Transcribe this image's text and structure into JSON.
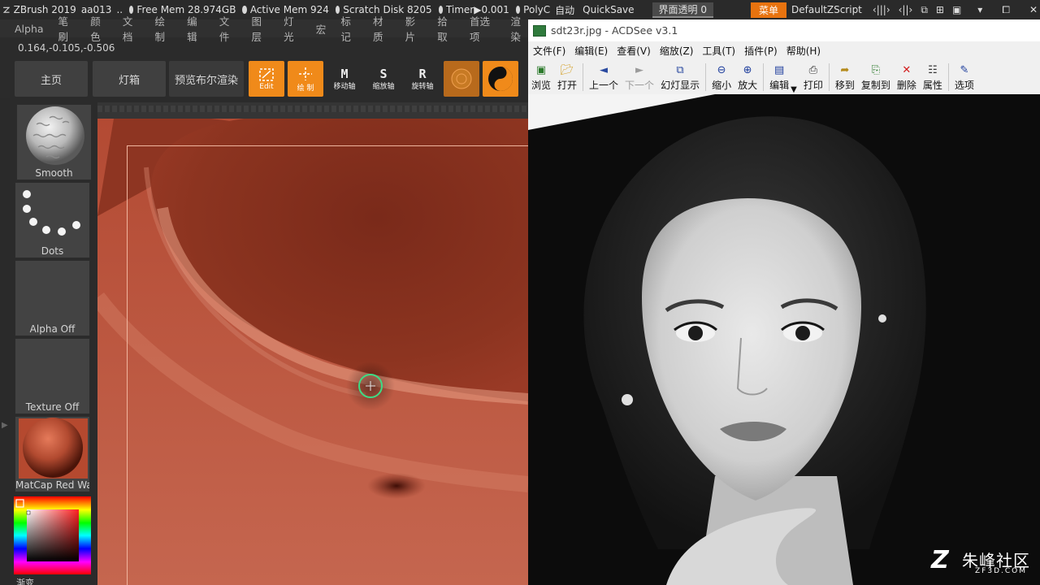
{
  "zbrush": {
    "title_bar": {
      "app_name": "ZBrush 2019",
      "project": "aa013",
      "ellipsis": "..",
      "free_mem": "Free Mem 28.974GB",
      "active_mem": "Active Mem 924",
      "scratch_disk": "Scratch Disk 8205",
      "timer": "Timer▶0.001",
      "polycount": "PolyC",
      "auto_label": "自动",
      "quicksave": "QuickSave",
      "transparency": "界面透明 0",
      "menu_button": "菜单",
      "zscript": "DefaultZScript"
    },
    "menu": [
      "Alpha",
      "笔刷",
      "颜色",
      "文档",
      "绘制",
      "编辑",
      "文件",
      "图层",
      "灯光",
      "宏",
      "标记",
      "材质",
      "影片",
      "拾取",
      "首选项",
      "渲染"
    ],
    "coords": "0.164,-0.105,-0.506",
    "tabs": {
      "home": "主页",
      "lightbox": "灯箱",
      "bpr": "预览布尔渲染"
    },
    "tools": {
      "edit": "Edit",
      "draw": "绘 制",
      "move": "移动轴",
      "scale": "缩放轴",
      "rotate": "旋转轴",
      "move_glyph": "M",
      "scale_glyph": "S",
      "rotate_glyph": "R"
    },
    "palette": {
      "brush": "Smooth",
      "stroke": "Dots",
      "alpha": "Alpha Off",
      "texture": "Texture Off",
      "material": "MatCap Red Wax",
      "gradient": "渐变"
    }
  },
  "acdsee": {
    "title": "sdt23r.jpg - ACDSee v3.1",
    "menu": [
      "文件(F)",
      "编辑(E)",
      "查看(V)",
      "缩放(Z)",
      "工具(T)",
      "插件(P)",
      "帮助(H)"
    ],
    "toolbar": {
      "browse": "浏览",
      "open": "打开",
      "prev": "上一个",
      "next": "下一个",
      "slideshow": "幻灯显示",
      "zoom_out": "缩小",
      "zoom_in": "放大",
      "edit": "编辑",
      "print": "打印",
      "move_to": "移到",
      "copy_to": "复制到",
      "delete": "删除",
      "properties": "属性",
      "options": "选项"
    }
  },
  "watermark": {
    "cn": "朱峰社区",
    "en": "ZF3D.COM"
  },
  "colors": {
    "orange": "#f08a1a",
    "clay": "#a8422c",
    "brush_ring": "#3ddc84"
  }
}
